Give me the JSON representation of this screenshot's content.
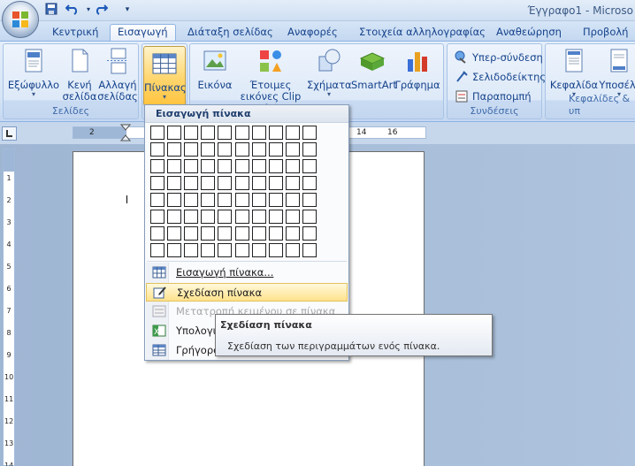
{
  "window": {
    "title": "Έγγραφο1 - Microso"
  },
  "quick_access": {
    "save_icon": "save-icon",
    "undo_icon": "undo-icon",
    "redo_icon": "redo-icon",
    "customize_icon": "customize-qat-icon"
  },
  "tabs": [
    {
      "label": "Κεντρική"
    },
    {
      "label": "Εισαγωγή"
    },
    {
      "label": "Διάταξη σελίδας"
    },
    {
      "label": "Αναφορές"
    },
    {
      "label": "Στοιχεία αλληλογραφίας"
    },
    {
      "label": "Αναθεώρηση"
    },
    {
      "label": "Προβολή"
    }
  ],
  "ribbon": {
    "groups": {
      "pages": {
        "label": "Σελίδες",
        "buttons": [
          {
            "label1": "Εξώφυλλο",
            "label2": ""
          },
          {
            "label1": "Κενή",
            "label2": "σελίδα"
          },
          {
            "label1": "Αλλαγή",
            "label2": "σελίδας"
          }
        ]
      },
      "tables": {
        "button": {
          "label1": "Πίνακας"
        }
      },
      "illustrations": {
        "buttons": [
          {
            "label1": "Εικόνα",
            "label2": ""
          },
          {
            "label1": "Έτοιμες",
            "label2": "εικόνες Clip Art"
          },
          {
            "label1": "Σχήματα",
            "label2": ""
          },
          {
            "label1": "SmartArt",
            "label2": ""
          },
          {
            "label1": "Γράφημα",
            "label2": ""
          }
        ]
      },
      "links": {
        "label": "Συνδέσεις",
        "items": [
          {
            "label": "Υπερ-σύνδεση"
          },
          {
            "label": "Σελιδοδείκτης"
          },
          {
            "label": "Παραπομπή"
          }
        ]
      },
      "header_footer": {
        "label": "Κεφαλίδες & υπ",
        "buttons": [
          {
            "label1": "Κεφαλίδα"
          },
          {
            "label1": "Υποσέλι"
          }
        ]
      }
    }
  },
  "ruler": {
    "ticks": [
      "2",
      "14",
      "16"
    ]
  },
  "vruler": {
    "ticks": [
      "1",
      "2",
      "3",
      "4",
      "5",
      "6",
      "7",
      "8",
      "9",
      "10",
      "11",
      "12",
      "13",
      "14"
    ]
  },
  "table_menu": {
    "header": "Εισαγωγή πίνακα",
    "grid": {
      "columns": 10,
      "rows": 8
    },
    "items": [
      {
        "label": "Εισαγωγή πίνακα..."
      },
      {
        "label": "Σχεδίαση πίνακα"
      },
      {
        "label": "Μετατροπή κειμένου σε πίνακα"
      },
      {
        "label": "Υπολογιστικό φύλλο του Excel"
      },
      {
        "label": "Γρήγοροι πίνακες"
      }
    ]
  },
  "tooltip": {
    "title": "Σχεδίαση πίνακα",
    "description": "Σχεδίαση των περιγραμμάτων ενός πίνακα."
  }
}
